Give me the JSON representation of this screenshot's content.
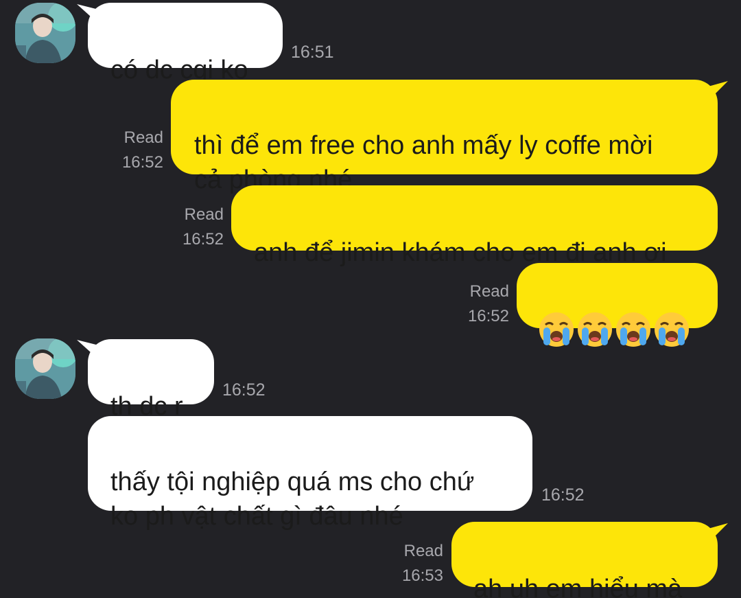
{
  "messages": [
    {
      "id": "m1",
      "text": "có dc cgi ko",
      "time": "16:51"
    },
    {
      "id": "m2",
      "text": "thì để em free cho anh mấy ly coffe mời\ncả phòng nhé",
      "read": "Read",
      "time": "16:52"
    },
    {
      "id": "m3",
      "text": "anh để jimin khám cho em đi anh ơi",
      "read": "Read",
      "time": "16:52"
    },
    {
      "id": "m4",
      "emoji": [
        "loudly-crying-face",
        "loudly-crying-face",
        "loudly-crying-face",
        "loudly-crying-face"
      ],
      "read": "Read",
      "time": "16:52"
    },
    {
      "id": "m5",
      "text": "th dc r",
      "time": "16:52"
    },
    {
      "id": "m6",
      "text": "thấy tội nghiệp quá ms cho chứ\nko ph vật chất gì đâu nhé",
      "time": "16:52"
    },
    {
      "id": "m7",
      "text": "ah uh em hiểu mà",
      "read": "Read",
      "time": "16:53"
    }
  ],
  "colors": {
    "background": "#222226",
    "incoming_bubble": "#ffffff",
    "outgoing_bubble": "#fde509",
    "meta_text": "#a8a8ad"
  }
}
